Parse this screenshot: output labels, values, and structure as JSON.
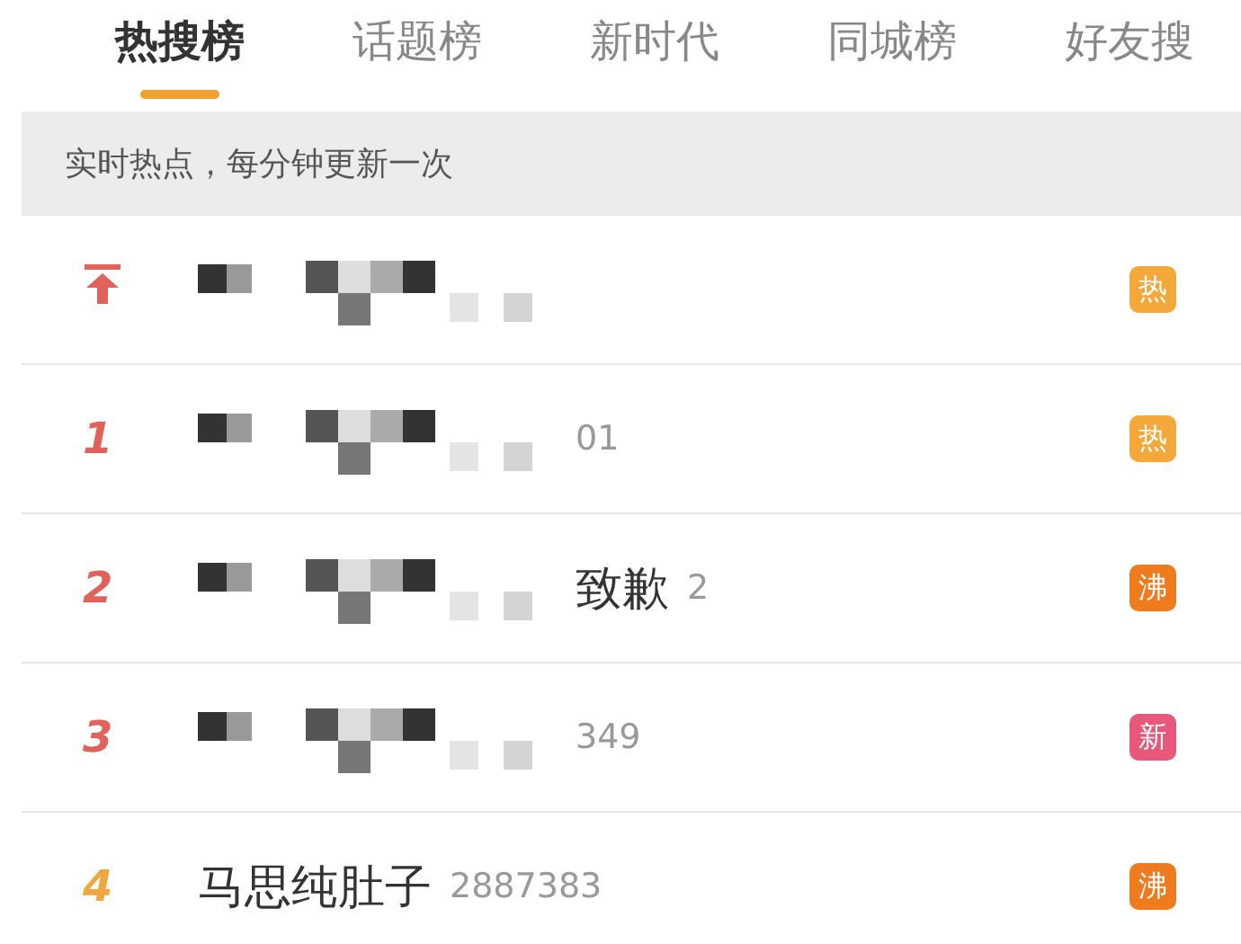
{
  "tabs": [
    {
      "label": "热搜榜",
      "selected": true
    },
    {
      "label": "话题榜",
      "selected": false
    },
    {
      "label": "新时代",
      "selected": false
    },
    {
      "label": "同城榜",
      "selected": false
    },
    {
      "label": "好友搜",
      "selected": false
    }
  ],
  "notice": "实时热点，每分钟更新一次",
  "rows": [
    {
      "kind": "pinned",
      "color": "#e0625a",
      "redacted": true,
      "badge": {
        "label": "热",
        "color": "#f4a83a"
      }
    },
    {
      "kind": "ranked",
      "rank": "1",
      "color": "#e0625a",
      "redacted": true,
      "count": "01",
      "badge": {
        "label": "热",
        "color": "#f4a83a"
      }
    },
    {
      "kind": "ranked",
      "rank": "2",
      "color": "#e0625a",
      "redacted": true,
      "title": "致歉",
      "count": "2",
      "badge": {
        "label": "沸",
        "color": "#ef7b1f"
      }
    },
    {
      "kind": "ranked",
      "rank": "3",
      "color": "#e0625a",
      "redacted": true,
      "count": "349",
      "badge": {
        "label": "新",
        "color": "#e8587a"
      }
    },
    {
      "kind": "ranked",
      "rank": "4",
      "color": "#f0a641",
      "title": "马思纯肚子",
      "count": "2887383",
      "badge": {
        "label": "沸",
        "color": "#ef7b1f"
      }
    }
  ]
}
